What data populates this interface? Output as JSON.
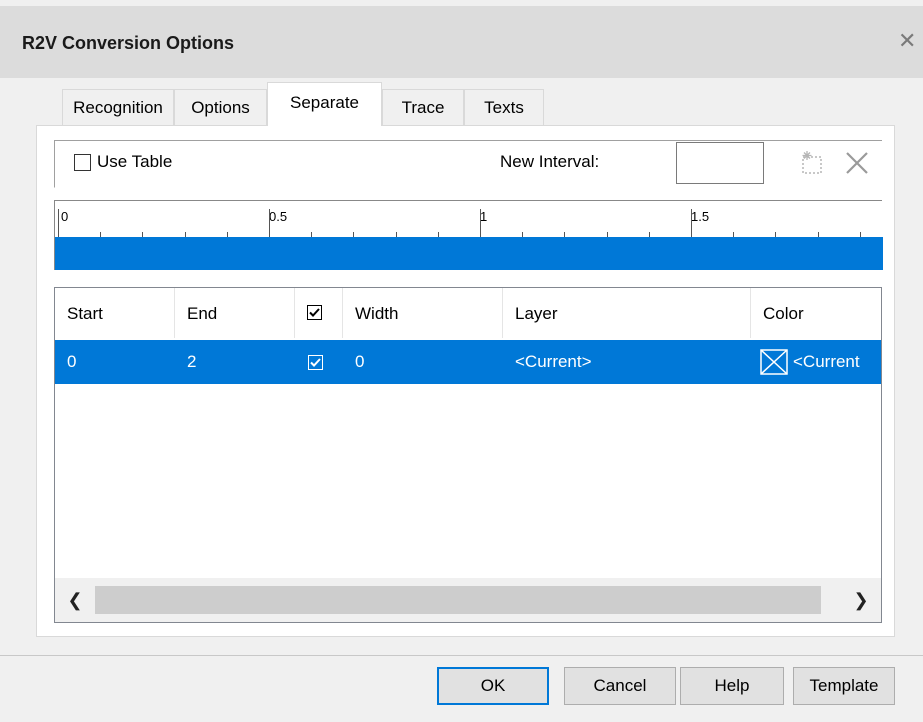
{
  "window": {
    "title": "R2V Conversion Options",
    "close_icon": "close-icon"
  },
  "tabs": [
    {
      "label": "Recognition"
    },
    {
      "label": "Options"
    },
    {
      "label": "Separate",
      "active": true
    },
    {
      "label": "Trace"
    },
    {
      "label": "Texts"
    }
  ],
  "separate": {
    "use_table_label": "Use Table",
    "use_table_checked": false,
    "new_interval_label": "New Interval:",
    "new_interval_value": ""
  },
  "ruler": {
    "labels": [
      "0",
      "0.5",
      "1",
      "1.5"
    ]
  },
  "table": {
    "columns": [
      "Start",
      "End",
      "",
      "Width",
      "Layer",
      "Color"
    ],
    "header_checkbox_checked": true,
    "rows": [
      {
        "start": "0",
        "end": "2",
        "checked": true,
        "width": "0",
        "layer": "<Current>",
        "color": "<Current"
      }
    ]
  },
  "buttons": {
    "ok": "OK",
    "cancel": "Cancel",
    "help": "Help",
    "template": "Template"
  },
  "colors": {
    "selection": "#0078d7",
    "dialog_bg": "#f0f0f0"
  }
}
